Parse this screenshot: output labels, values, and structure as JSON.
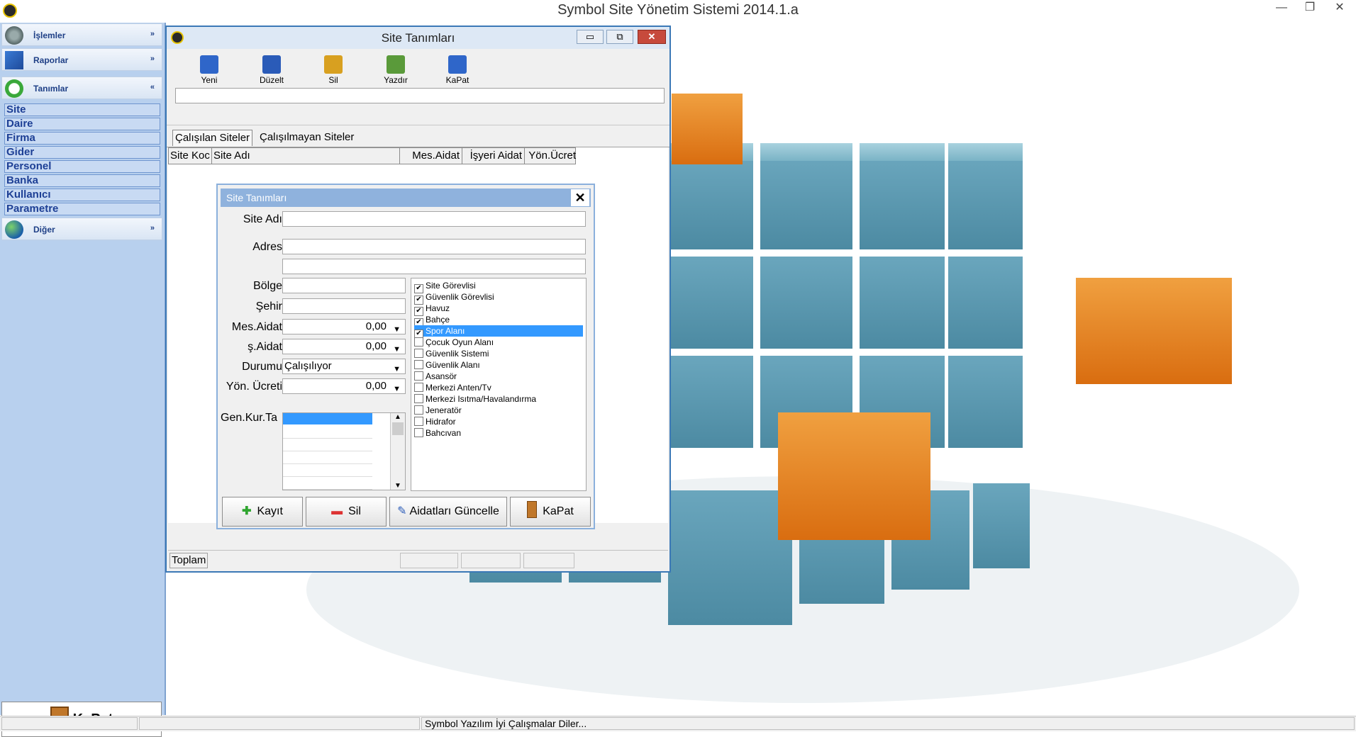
{
  "app": {
    "title": "Symbol Site Yönetim Sistemi 2014.1.a"
  },
  "window_controls": {
    "minimize": "—",
    "maximize": "❐",
    "close": "✕"
  },
  "sidebar": {
    "groups": [
      {
        "label": "İşlemler",
        "chevron": "»"
      },
      {
        "label": "Raporlar",
        "chevron": "»"
      },
      {
        "label": "Tanımlar",
        "chevron": "«"
      },
      {
        "label": "Diğer",
        "chevron": "»"
      }
    ],
    "items": [
      "Site",
      "Daire",
      "Firma",
      "Gider",
      "Personel",
      "Banka",
      "Kullanıcı",
      "Parametre"
    ],
    "kapat_label": "KaPat"
  },
  "statusbar": {
    "message": "Symbol Yazılım İyi Çalışmalar Diler..."
  },
  "inner_window": {
    "title": "Site Tanımları",
    "controls": {
      "minimize": "▭",
      "maximize": "⧉",
      "close": "✕"
    },
    "toolbar": [
      {
        "label": "Yeni",
        "color": "#2f66c9"
      },
      {
        "label": "Düzelt",
        "color": "#2a5bb8"
      },
      {
        "label": "Sil",
        "color": "#d8a020"
      },
      {
        "label": "Yazdır",
        "color": "#5a9a3a"
      },
      {
        "label": "KaPat",
        "color": "#2f66c9"
      }
    ],
    "tabs": [
      "Çalışılan Siteler",
      "Çalışılmayan Siteler"
    ],
    "columns": [
      "Site Koc",
      "Site Adı",
      "Mes.Aidat",
      "İşyeri Aidat",
      "Yön.Ücret"
    ],
    "footer_label": "Toplam"
  },
  "dialog": {
    "title": "Site Tanımları",
    "close": "✕",
    "labels": {
      "site_adi": "Site Adı",
      "adres": "Adres",
      "bolge": "Bölge",
      "sehir": "Şehir",
      "mes_aidat": "Mes.Aidat",
      "is_aidat": "ş.Aidat",
      "durumu": "Durumu",
      "yon_ucreti": "Yön. Ücreti",
      "gen_kur": "Gen.Kur.Ta"
    },
    "values": {
      "mes_aidat": "0,00",
      "is_aidat": "0,00",
      "durumu": "Çalışılıyor",
      "yon_ucreti": "0,00"
    },
    "features": [
      {
        "label": "Site Görevlisi",
        "checked": true
      },
      {
        "label": "Güvenlik Görevlisi",
        "checked": true
      },
      {
        "label": "Havuz",
        "checked": true
      },
      {
        "label": "Bahçe",
        "checked": true
      },
      {
        "label": "Spor Alanı",
        "checked": true,
        "selected": true
      },
      {
        "label": "Çocuk Oyun Alanı",
        "checked": false
      },
      {
        "label": "Güvenlik Sistemi",
        "checked": false
      },
      {
        "label": "Güvenlik Alanı",
        "checked": false
      },
      {
        "label": "Asansör",
        "checked": false
      },
      {
        "label": "Merkezi Anten/Tv",
        "checked": false
      },
      {
        "label": "Merkezi Isıtma/Havalandırma",
        "checked": false
      },
      {
        "label": "Jeneratör",
        "checked": false
      },
      {
        "label": "Hidrafor",
        "checked": false
      },
      {
        "label": "Bahcıvan",
        "checked": false
      }
    ],
    "buttons": [
      {
        "label": "Kayıt",
        "icon": "add-icon"
      },
      {
        "label": "Sil",
        "icon": "delete-icon"
      },
      {
        "label": "Aidatları Güncelle",
        "icon": "pencil-icon"
      },
      {
        "label": "KaPat",
        "icon": "door-icon"
      }
    ]
  },
  "colors": {
    "sidebar_bg": "#b8d0ee",
    "accent": "#3b78b6",
    "cube_blue": "#6aa6bd",
    "cube_orange": "#e37b12"
  }
}
